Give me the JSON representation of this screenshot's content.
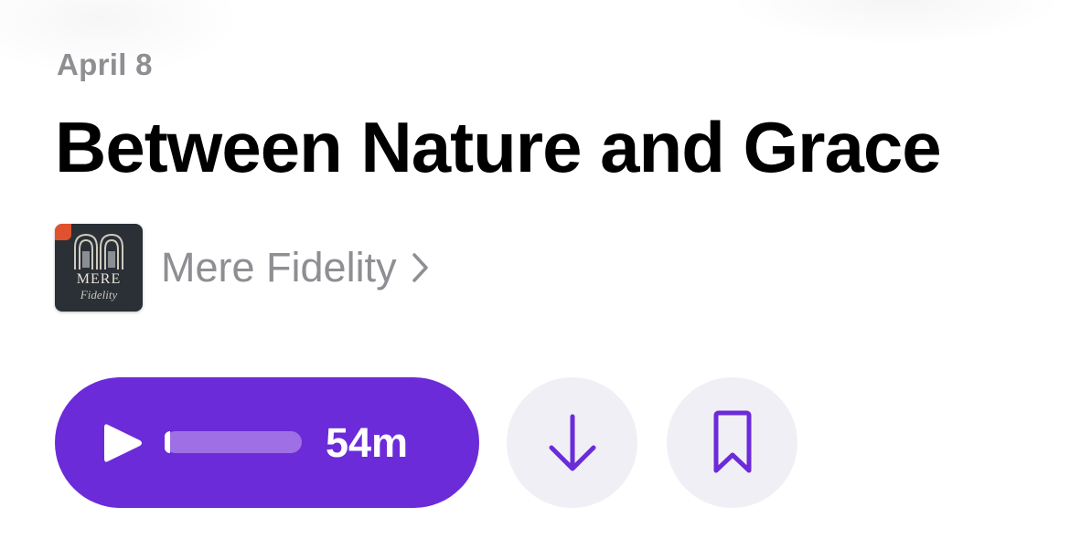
{
  "episode": {
    "date": "April 8",
    "title": "Between Nature and Grace"
  },
  "show": {
    "name": "Mere Fidelity",
    "artwork_title": "MERE",
    "artwork_subtitle": "Fidelity"
  },
  "player": {
    "duration": "54m",
    "progress_fraction": 0.02,
    "play_icon": "play-icon",
    "download_icon": "arrow-down-icon",
    "bookmark_icon": "bookmark-icon"
  },
  "colors": {
    "accent": "#6c2bd9",
    "secondary_text": "#8e8e93",
    "circle_button_bg": "#f1eff6",
    "progress_track": "#9f6fe6"
  }
}
